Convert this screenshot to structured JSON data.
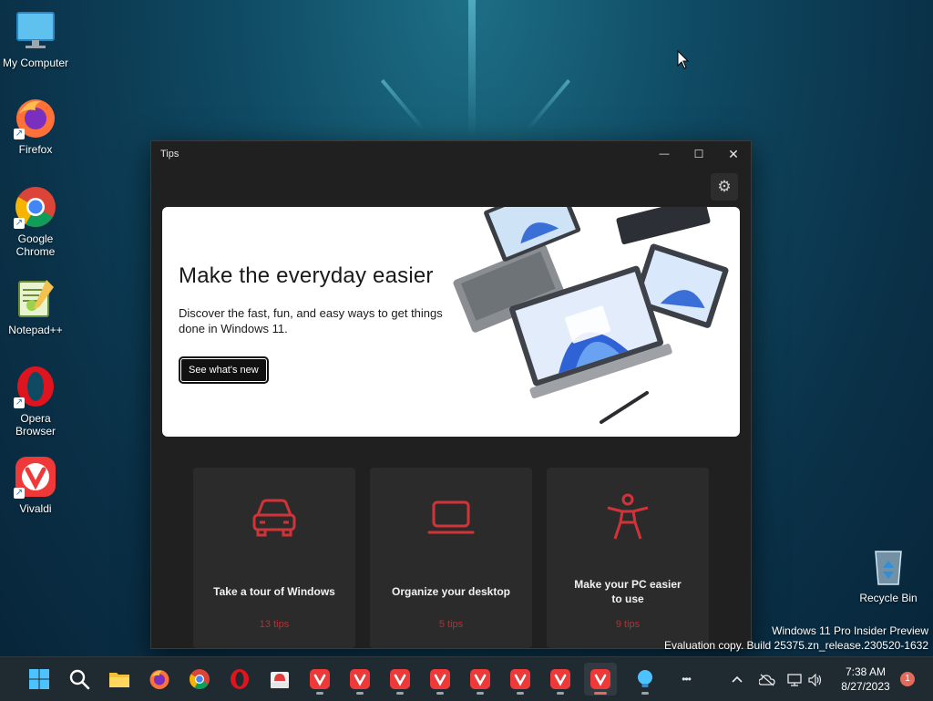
{
  "desktop": {
    "icons": [
      {
        "label": "My Computer"
      },
      {
        "label": "Firefox"
      },
      {
        "label": "Google Chrome"
      },
      {
        "label": "Notepad++"
      },
      {
        "label": "Opera Browser"
      },
      {
        "label": "Vivaldi"
      },
      {
        "label": "Recycle Bin"
      }
    ],
    "watermark": {
      "line1": "Windows 11 Pro Insider Preview",
      "line2": "Evaluation copy. Build 25375.zn_release.230520-1632"
    }
  },
  "window": {
    "title": "Tips",
    "controls": {
      "minimize": "—",
      "maximize": "☐",
      "close": "✕"
    },
    "settings_icon": "⚙",
    "hero": {
      "heading": "Make the everyday easier",
      "description": "Discover the fast, fun, and easy ways to get things done in Windows 11.",
      "button": "See what's new"
    },
    "cards": [
      {
        "title": "Take a tour of Windows",
        "count": "13 tips",
        "icon": "car-icon"
      },
      {
        "title": "Organize your desktop",
        "count": "5 tips",
        "icon": "laptop-icon"
      },
      {
        "title": "Make your PC easier to use",
        "count": "9 tips",
        "icon": "accessibility-icon"
      }
    ]
  },
  "taskbar": {
    "more": "•••",
    "clock": {
      "time": "7:38 AM",
      "date": "8/27/2023"
    },
    "notifications": "1"
  },
  "colors": {
    "accent": "#d13438",
    "window_bg": "#202020",
    "card_bg": "#2b2b2b"
  }
}
